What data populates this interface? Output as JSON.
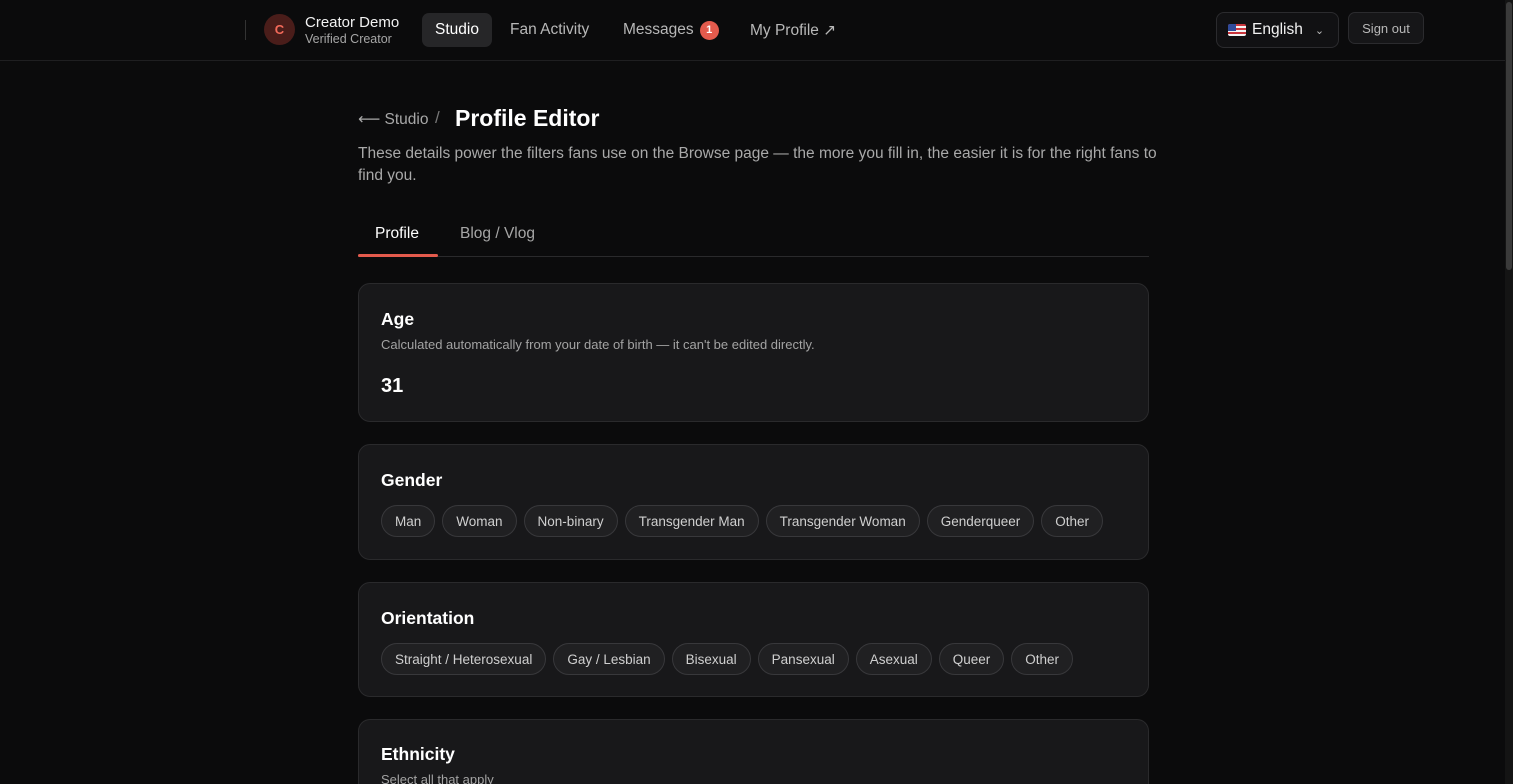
{
  "topbar": {
    "avatar_letter": "C",
    "user_name": "Creator Demo",
    "user_subtitle": "Verified Creator",
    "nav": [
      {
        "label": "Studio",
        "active": true
      },
      {
        "label": "Fan Activity",
        "active": false
      },
      {
        "label": "Messages",
        "active": false,
        "badge": "1"
      },
      {
        "label": "My Profile ↗",
        "active": false
      }
    ],
    "language": {
      "flag": "us-flag-icon",
      "label": "English"
    },
    "sign_out": "Sign out"
  },
  "breadcrumb": {
    "back_label": "⟵ Studio",
    "separator": "/",
    "title": "Profile Editor"
  },
  "subtitle": "These details power the filters fans use on the Browse page — the more you fill in, the easier it is for the right fans to find you.",
  "tabs": [
    {
      "label": "Profile",
      "active": true
    },
    {
      "label": "Blog / Vlog",
      "active": false
    }
  ],
  "sections": {
    "age": {
      "title": "Age",
      "hint": "Calculated automatically from your date of birth — it can't be edited directly.",
      "value": "31"
    },
    "gender": {
      "title": "Gender",
      "options": [
        "Man",
        "Woman",
        "Non-binary",
        "Transgender Man",
        "Transgender Woman",
        "Genderqueer",
        "Other"
      ]
    },
    "orientation": {
      "title": "Orientation",
      "options": [
        "Straight / Heterosexual",
        "Gay / Lesbian",
        "Bisexual",
        "Pansexual",
        "Asexual",
        "Queer",
        "Other"
      ]
    },
    "ethnicity": {
      "title": "Ethnicity",
      "hint": "Select all that apply"
    }
  },
  "colors": {
    "background": "#0b0b0c",
    "accent": "#e45b4d",
    "card": "#18181a"
  }
}
